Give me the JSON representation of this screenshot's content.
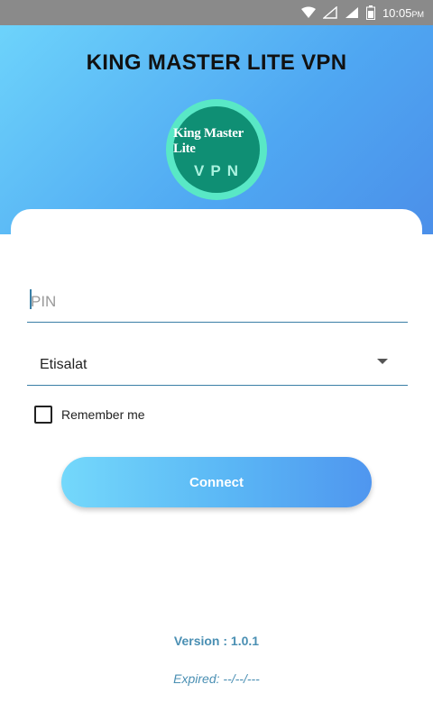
{
  "status_bar": {
    "time": "10:05",
    "time_suffix": "PM",
    "icons": [
      "wifi-icon",
      "signal-empty-icon",
      "signal-icon",
      "battery-icon"
    ]
  },
  "header": {
    "title": "KING MASTER LITE VPN",
    "gradient_colors": [
      "#6dd3fb",
      "#4b8fe9"
    ]
  },
  "logo": {
    "line1": "King Master Lite",
    "line2": "VPN",
    "ring_color": "#59e8c6",
    "inner_color": "#0f8f74"
  },
  "form": {
    "pin_placeholder": "PIN",
    "pin_value": "",
    "server_selected": "Etisalat",
    "remember_label": "Remember me",
    "remember_checked": false,
    "connect_label": "Connect"
  },
  "footer": {
    "version": "Version : 1.0.1",
    "expired": "Expired:   --/--/---"
  },
  "colors": {
    "accent": "#3a7fa6",
    "footer_text": "#4a8fb3"
  }
}
